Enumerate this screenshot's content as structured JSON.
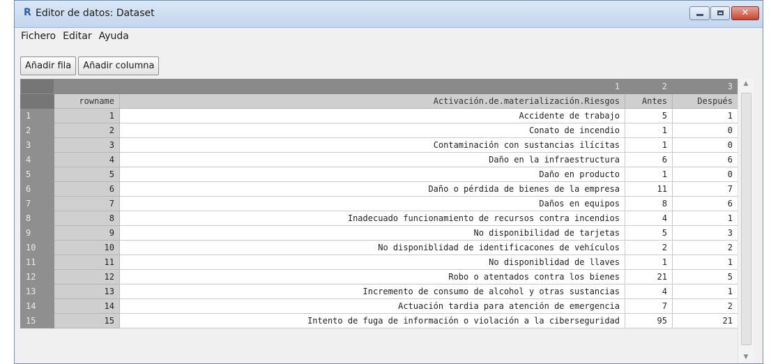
{
  "window": {
    "app_icon": "R",
    "title": "Editor de datos: Dataset",
    "controls": {
      "close": "✕"
    }
  },
  "menu": [
    "Fichero",
    "Editar",
    "Ayuda"
  ],
  "toolbar": {
    "add_row": "Añadir fila",
    "add_column": "Añadir columna"
  },
  "table": {
    "column_numbers": [
      "1",
      "2",
      "3"
    ],
    "headers": [
      "rowname",
      "Activación.de.materialización.Riesgos",
      "Antes",
      "Después"
    ],
    "rows": [
      {
        "num": "1",
        "rowname": "1",
        "riesgo": "Accidente de trabajo",
        "antes": "5",
        "despues": "1"
      },
      {
        "num": "2",
        "rowname": "2",
        "riesgo": "Conato de incendio",
        "antes": "1",
        "despues": "0"
      },
      {
        "num": "3",
        "rowname": "3",
        "riesgo": "Contaminación con sustancias ilícitas",
        "antes": "1",
        "despues": "0"
      },
      {
        "num": "4",
        "rowname": "4",
        "riesgo": "Daño en la infraestructura",
        "antes": "6",
        "despues": "6"
      },
      {
        "num": "5",
        "rowname": "5",
        "riesgo": "Daño en producto",
        "antes": "1",
        "despues": "0"
      },
      {
        "num": "6",
        "rowname": "6",
        "riesgo": "Daño o pérdida de bienes de la empresa",
        "antes": "11",
        "despues": "7"
      },
      {
        "num": "7",
        "rowname": "7",
        "riesgo": "Daños en equipos",
        "antes": "8",
        "despues": "6"
      },
      {
        "num": "8",
        "rowname": "8",
        "riesgo": "Inadecuado funcionamiento de recursos contra incendios",
        "antes": "4",
        "despues": "1"
      },
      {
        "num": "9",
        "rowname": "9",
        "riesgo": "No disponibilidad de tarjetas",
        "antes": "5",
        "despues": "3"
      },
      {
        "num": "10",
        "rowname": "10",
        "riesgo": "No disponiblidad de identificacones de vehículos",
        "antes": "2",
        "despues": "2"
      },
      {
        "num": "11",
        "rowname": "11",
        "riesgo": "No disponiblidad de llaves",
        "antes": "1",
        "despues": "1"
      },
      {
        "num": "12",
        "rowname": "12",
        "riesgo": "Robo o atentados contra los bienes",
        "antes": "21",
        "despues": "5"
      },
      {
        "num": "13",
        "rowname": "13",
        "riesgo": "Incremento de consumo de alcohol y otras sustancias",
        "antes": "4",
        "despues": "1"
      },
      {
        "num": "14",
        "rowname": "14",
        "riesgo": "Actuación tardia para atención de emergencia",
        "antes": "7",
        "despues": "2"
      },
      {
        "num": "15",
        "rowname": "15",
        "riesgo": "Intento de fuga de información o violación a la ciberseguridad",
        "antes": "95",
        "despues": "21"
      }
    ]
  },
  "scrollbar": {
    "up": "▲",
    "down": "▼"
  }
}
